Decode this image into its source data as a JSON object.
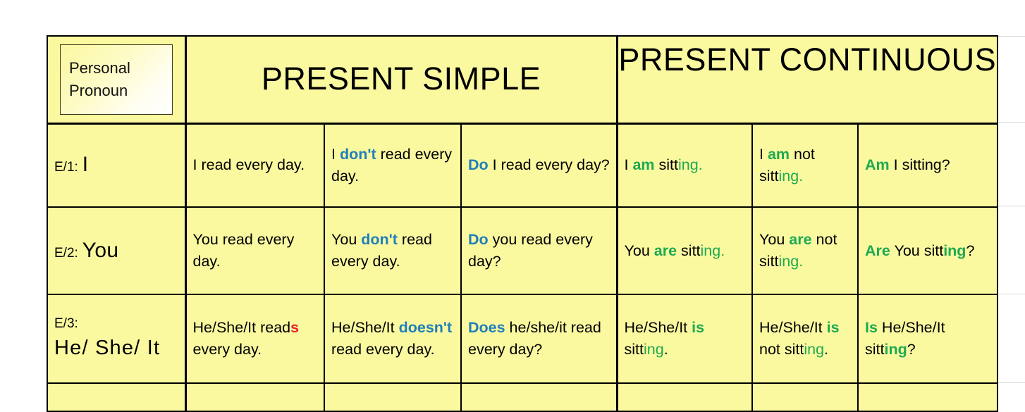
{
  "table": {
    "pronoun_header": {
      "line1": "Personal",
      "line2": "Pronoun"
    },
    "tense_headers": [
      {
        "label": "PRESENT SIMPLE",
        "span": 3
      },
      {
        "label": "PRESENT CONTINUOUS",
        "span": 3
      }
    ],
    "rows": [
      {
        "code": "E/1:",
        "pronoun": "I",
        "present_simple_affirmative": {
          "parts": [
            {
              "text": "I read every day.",
              "style": "plain"
            }
          ]
        },
        "present_simple_negative": {
          "parts": [
            {
              "text": "I ",
              "style": "plain"
            },
            {
              "text": "don't",
              "style": "neg"
            },
            {
              "text": " read every day.",
              "style": "plain"
            }
          ]
        },
        "present_simple_question": {
          "parts": [
            {
              "text": "Do",
              "style": "aux"
            },
            {
              "text": " I read every day?",
              "style": "plain"
            }
          ]
        },
        "present_continuous_affirmative": {
          "parts": [
            {
              "text": "I ",
              "style": "plain"
            },
            {
              "text": "am",
              "style": "be"
            },
            {
              "text": " sitt",
              "style": "plain"
            },
            {
              "text": "ing",
              "style": "ing"
            },
            {
              "text": ".",
              "style": "ing"
            }
          ]
        },
        "present_continuous_negative": {
          "parts": [
            {
              "text": "I ",
              "style": "plain"
            },
            {
              "text": "am",
              "style": "be"
            },
            {
              "text": " not sitt",
              "style": "plain"
            },
            {
              "text": "ing",
              "style": "ing"
            },
            {
              "text": ".",
              "style": "ing"
            }
          ]
        },
        "present_continuous_question": {
          "parts": [
            {
              "text": "Am",
              "style": "be"
            },
            {
              "text": " I sitting?",
              "style": "plain"
            }
          ]
        }
      },
      {
        "code": "E/2:",
        "pronoun": "You",
        "present_simple_affirmative": {
          "parts": [
            {
              "text": "You read every day.",
              "style": "plain"
            }
          ]
        },
        "present_simple_negative": {
          "parts": [
            {
              "text": "You ",
              "style": "plain"
            },
            {
              "text": "don't",
              "style": "neg"
            },
            {
              "text": " read every day.",
              "style": "plain"
            }
          ]
        },
        "present_simple_question": {
          "parts": [
            {
              "text": "Do",
              "style": "aux"
            },
            {
              "text": " you read every day?",
              "style": "plain"
            }
          ]
        },
        "present_continuous_affirmative": {
          "parts": [
            {
              "text": "You ",
              "style": "plain"
            },
            {
              "text": "are",
              "style": "be"
            },
            {
              "text": " sitt",
              "style": "plain"
            },
            {
              "text": "ing",
              "style": "ing"
            },
            {
              "text": ".",
              "style": "ing"
            }
          ]
        },
        "present_continuous_negative": {
          "parts": [
            {
              "text": "You ",
              "style": "plain"
            },
            {
              "text": "are",
              "style": "be"
            },
            {
              "text": " not sitt",
              "style": "plain"
            },
            {
              "text": "ing",
              "style": "ing"
            },
            {
              "text": ".",
              "style": "ing"
            }
          ]
        },
        "present_continuous_question": {
          "parts": [
            {
              "text": "Are",
              "style": "be"
            },
            {
              "text": " You sitt",
              "style": "plain"
            },
            {
              "text": "ing",
              "style": "ing-b"
            },
            {
              "text": "?",
              "style": "plain"
            }
          ]
        }
      },
      {
        "code": "E/3:",
        "pronoun": "He/ She/ It",
        "present_simple_affirmative": {
          "parts": [
            {
              "text": "He/She/It read",
              "style": "plain"
            },
            {
              "text": "s",
              "style": "s-red"
            },
            {
              "text": " every day.",
              "style": "plain"
            }
          ]
        },
        "present_simple_negative": {
          "parts": [
            {
              "text": "He/She/It ",
              "style": "plain"
            },
            {
              "text": "doesn't",
              "style": "neg"
            },
            {
              "text": " read every day.",
              "style": "plain"
            }
          ]
        },
        "present_simple_question": {
          "parts": [
            {
              "text": "Does",
              "style": "aux"
            },
            {
              "text": " he/she/it read every day?",
              "style": "plain"
            }
          ]
        },
        "present_continuous_affirmative": {
          "parts": [
            {
              "text": "He/She/It ",
              "style": "plain"
            },
            {
              "text": "is",
              "style": "be"
            },
            {
              "text": " sitt",
              "style": "plain"
            },
            {
              "text": "ing",
              "style": "ing"
            },
            {
              "text": ".",
              "style": "plain"
            }
          ]
        },
        "present_continuous_negative": {
          "parts": [
            {
              "text": "He/She/It ",
              "style": "plain"
            },
            {
              "text": "is",
              "style": "be"
            },
            {
              "text": " not sitt",
              "style": "plain"
            },
            {
              "text": "ing",
              "style": "ing"
            },
            {
              "text": ".",
              "style": "plain"
            }
          ]
        },
        "present_continuous_question": {
          "parts": [
            {
              "text": "Is",
              "style": "be"
            },
            {
              "text": " He/She/It sitt",
              "style": "plain"
            },
            {
              "text": "ing",
              "style": "ing-b"
            },
            {
              "text": "?",
              "style": "plain"
            }
          ]
        }
      },
      {
        "code": "",
        "pronoun": "",
        "present_simple_affirmative": {
          "parts": []
        },
        "present_simple_negative": {
          "parts": []
        },
        "present_simple_question": {
          "parts": []
        },
        "present_continuous_affirmative": {
          "parts": []
        },
        "present_continuous_negative": {
          "parts": []
        },
        "present_continuous_question": {
          "parts": []
        }
      }
    ]
  },
  "colors": {
    "cell_background": "#FBF9A0",
    "grid_border": "#000000",
    "auxiliary_blue": "#1F7FBA",
    "be_verb_green": "#1EAA51",
    "third_person_s_red": "#E8232A",
    "page_background": "#FFFFFF"
  }
}
